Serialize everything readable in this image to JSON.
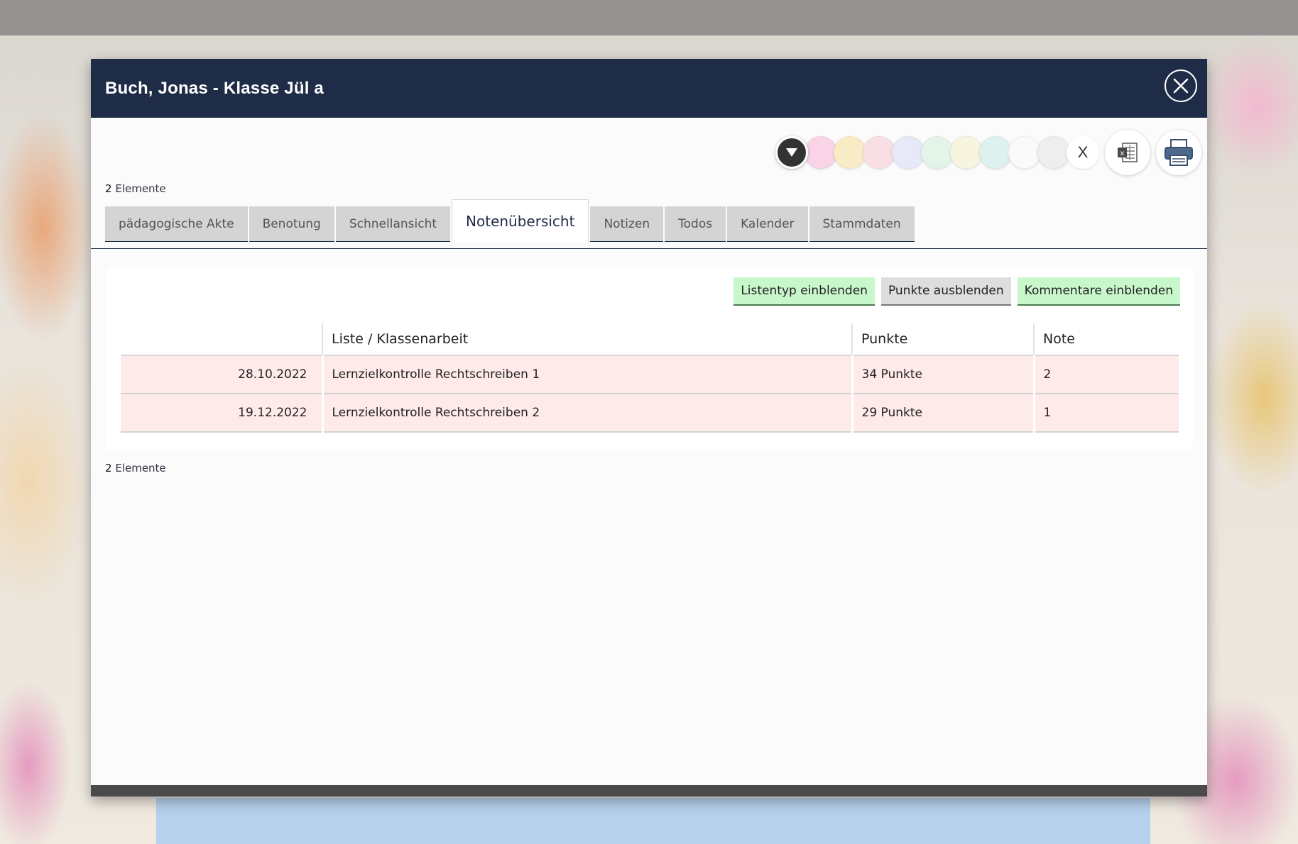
{
  "dialog": {
    "title": "Buch, Jonas - Klasse Jül a"
  },
  "toolbar": {
    "clear_label": "X",
    "swatches": [
      "#f9d4e6",
      "#f8ebc6",
      "#f9dfe4",
      "#e7e9f8",
      "#e3f4e8",
      "#f7f4df",
      "#dff1ef",
      "#fafafa",
      "#eeeeee"
    ]
  },
  "count_top": {
    "number": "2",
    "label": "Elemente"
  },
  "count_bottom": {
    "number": "2",
    "label": "Elemente"
  },
  "tabs": [
    {
      "label": "pädagogische Akte"
    },
    {
      "label": "Benotung"
    },
    {
      "label": "Schnellansicht"
    },
    {
      "label": "Notenübersicht"
    },
    {
      "label": "Notizen"
    },
    {
      "label": "Todos"
    },
    {
      "label": "Kalender"
    },
    {
      "label": "Stammdaten"
    }
  ],
  "actions": {
    "listentyp": "Listentyp einblenden",
    "punkte": "Punkte ausblenden",
    "kommentare": "Kommentare einblenden"
  },
  "table": {
    "headers": [
      "",
      "Liste / Klassenarbeit",
      "Punkte",
      "Note"
    ],
    "rows": [
      [
        "28.10.2022",
        "Lernzielkontrolle Rechtschreiben 1",
        "34 Punkte",
        "2"
      ],
      [
        "19.12.2022",
        "Lernzielkontrolle Rechtschreiben 2",
        "29 Punkte",
        "1"
      ]
    ]
  },
  "colors": {
    "titlebar": "#1f2c48",
    "row_highlight": "#ffeaea",
    "action_green": "#c9f7cc"
  }
}
